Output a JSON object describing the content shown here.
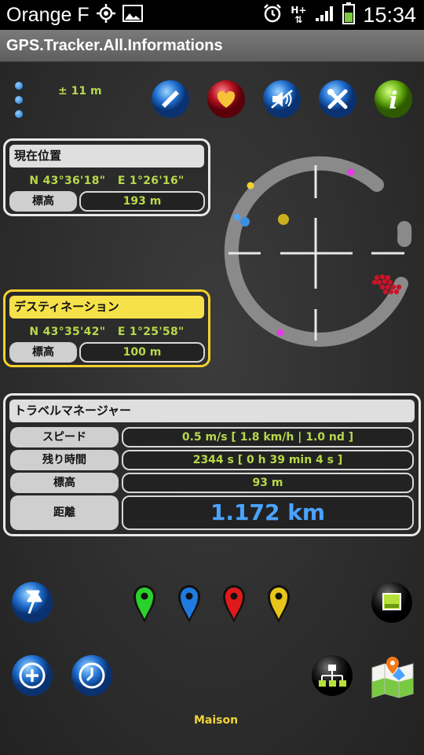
{
  "status": {
    "carrier": "Orange F",
    "network": "H+",
    "time": "15:34"
  },
  "app": {
    "title": "GPS.Tracker.All.Informations"
  },
  "toolbar": {
    "accuracy": "± 11 m",
    "buttons": [
      "satellite-icon",
      "heart-icon",
      "sound-off-icon",
      "tools-icon",
      "info-icon"
    ]
  },
  "current": {
    "title": "現在位置",
    "lat": "N 43°36'18\"",
    "lon": "E 1°26'16\"",
    "alt_label": "標高",
    "alt_value": "193 m"
  },
  "destination": {
    "title": "デスティネーション",
    "lat": "N 43°35'42\"",
    "lon": "E 1°25'58\"",
    "alt_label": "標高",
    "alt_value": "100 m"
  },
  "travel": {
    "title": "トラベルマネージャー",
    "rows": [
      {
        "label": "スピード",
        "value": "0.5 m/s  [ 1.8 km/h  |  1.0 nd ]"
      },
      {
        "label": "残り時間",
        "value": "2344 s  [ 0 h 39 min 4 s ]"
      },
      {
        "label": "標高",
        "value": "93 m"
      },
      {
        "label": "距離",
        "value": "1.172 km"
      }
    ]
  },
  "markers": {
    "colors": [
      "#2bd12b",
      "#1f7be0",
      "#e01a1a",
      "#e8c51a"
    ]
  },
  "footer": {
    "label": "Maison"
  },
  "colors": {
    "accent": "#b8d84a",
    "destination": "#f3d12d",
    "distance": "#4aa3ff"
  }
}
